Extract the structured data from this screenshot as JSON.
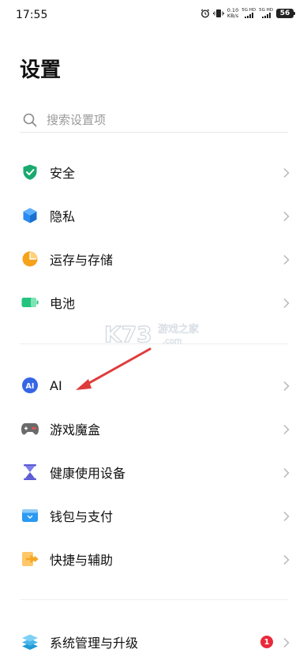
{
  "status_bar": {
    "time": "17:55",
    "speed_value": "0.10",
    "speed_unit": "KB/s",
    "network1": "5G HD",
    "network2": "5G HD",
    "battery": "56",
    "icons": [
      "alarm-icon",
      "vibrate-icon"
    ]
  },
  "page": {
    "title": "设置"
  },
  "search": {
    "placeholder": "搜索设置项",
    "value": ""
  },
  "items": [
    {
      "label": "安全",
      "icon": "shield-icon",
      "color": "#1aaa6e"
    },
    {
      "label": "隐私",
      "icon": "privacy-cube-icon",
      "color": "#2a8cf0"
    },
    {
      "label": "运存与存储",
      "icon": "storage-pie-icon",
      "color": "#f7a21b"
    },
    {
      "label": "电池",
      "icon": "battery-icon",
      "color": "#22c47e"
    },
    {
      "label": "AI",
      "icon": "ai-icon",
      "color": "#3566e6"
    },
    {
      "label": "游戏魔盒",
      "icon": "gamepad-icon",
      "color": "#666666"
    },
    {
      "label": "健康使用设备",
      "icon": "hourglass-icon",
      "color": "#5b5bd6"
    },
    {
      "label": "钱包与支付",
      "icon": "wallet-icon",
      "color": "#2a9af2"
    },
    {
      "label": "快捷与辅助",
      "icon": "shortcut-icon",
      "color": "#f5a623"
    },
    {
      "label": "系统管理与升级",
      "icon": "system-layers-icon",
      "color": "#1f9ad6",
      "badge": "1"
    }
  ],
  "watermark": {
    "logo": "K73",
    "text": "游戏之家",
    "sub": ".com"
  },
  "colors": {
    "accent": "#2a8cf0",
    "badge": "#e9283a",
    "arrow": "#e03b3b"
  }
}
